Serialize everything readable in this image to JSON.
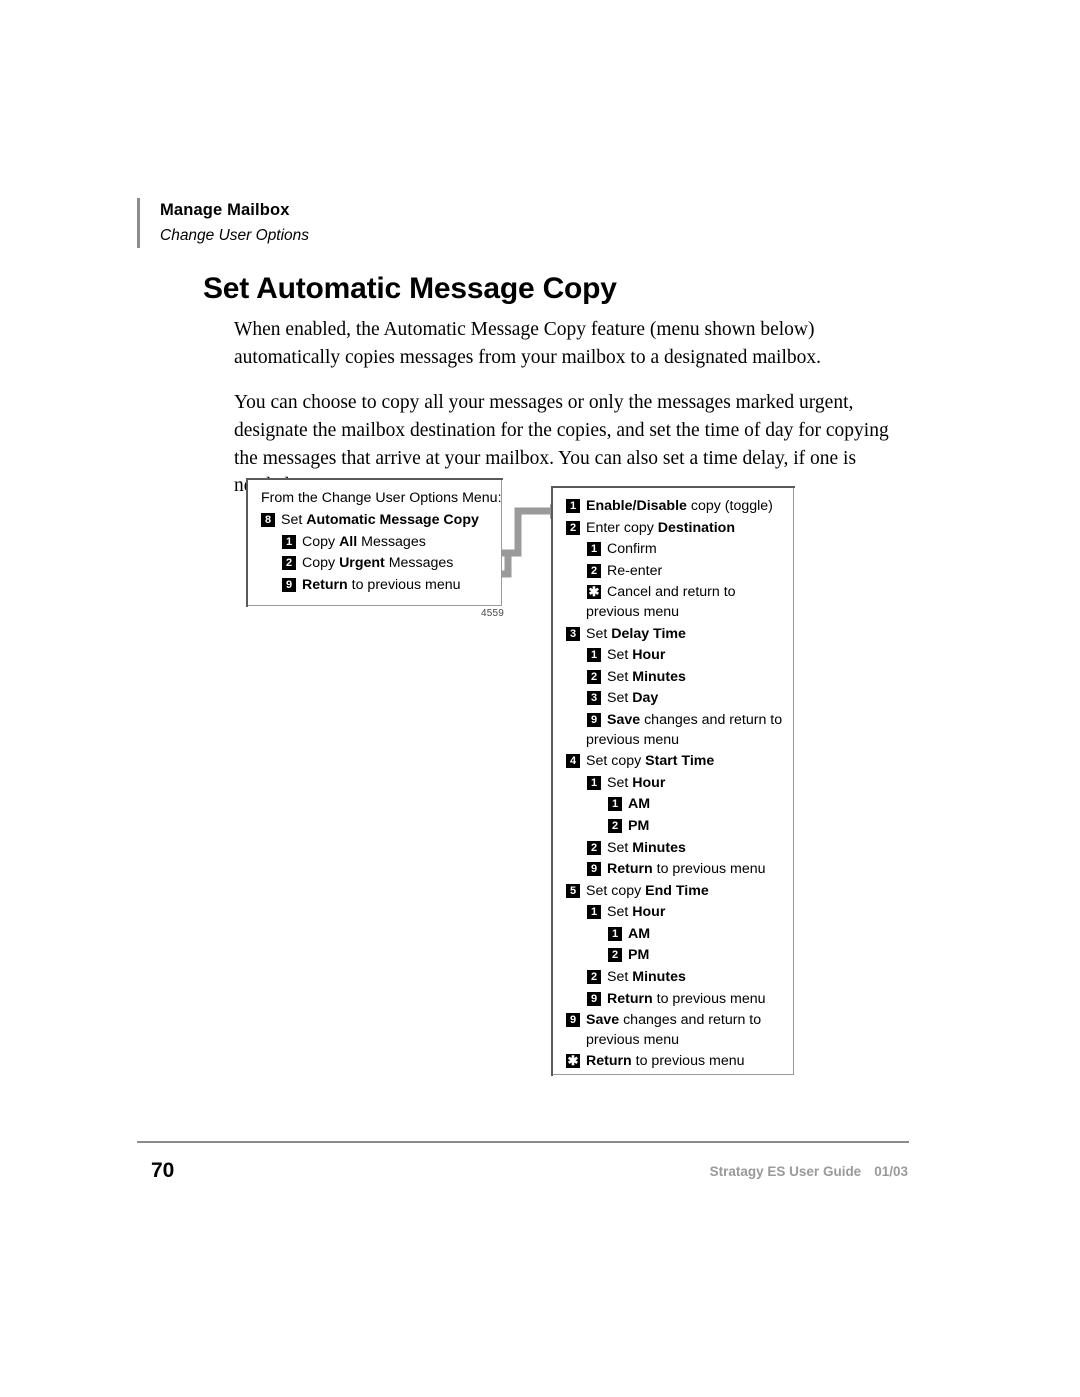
{
  "header": {
    "title": "Manage Mailbox",
    "subtitle": "Change User Options"
  },
  "heading": "Set Automatic Message Copy",
  "body": {
    "paragraph_1": "When enabled, the Automatic Message Copy feature (menu shown below) automatically copies messages from your mailbox to a designated mailbox.",
    "paragraph_2": "You can choose to copy all your messages or only the messages marked urgent, designate the mailbox destination for the copies, and set the time of day for copying the messages that arrive at your mailbox. You can also set a time delay, if one is needed."
  },
  "figure": {
    "id": "4559",
    "left_box": {
      "intro": "From the Change User Options Menu:",
      "items": [
        {
          "key": "8",
          "indent": 0,
          "prefix": "Set ",
          "bold": "Automatic Message Copy",
          "suffix": ""
        },
        {
          "key": "1",
          "indent": 1,
          "prefix": "Copy ",
          "bold": "All",
          "suffix": " Messages"
        },
        {
          "key": "2",
          "indent": 1,
          "prefix": "Copy ",
          "bold": "Urgent",
          "suffix": " Messages"
        },
        {
          "key": "9",
          "indent": 1,
          "prefix": "",
          "bold": "Return",
          "suffix": " to previous menu"
        }
      ]
    },
    "right_box": {
      "items": [
        {
          "key": "1",
          "indent": 0,
          "prefix": "",
          "bold": "Enable/Disable",
          "suffix": " copy (toggle)",
          "cont": ""
        },
        {
          "key": "2",
          "indent": 0,
          "prefix": "Enter copy ",
          "bold": "Destination",
          "suffix": "",
          "cont": ""
        },
        {
          "key": "1",
          "indent": 1,
          "prefix": "Confirm",
          "bold": "",
          "suffix": "",
          "cont": ""
        },
        {
          "key": "2",
          "indent": 1,
          "prefix": "Re-enter",
          "bold": "",
          "suffix": "",
          "cont": ""
        },
        {
          "key": "*",
          "indent": 1,
          "prefix": "Cancel and return to",
          "bold": "",
          "suffix": "",
          "cont": "previous menu"
        },
        {
          "key": "3",
          "indent": 0,
          "prefix": "Set ",
          "bold": "Delay Time",
          "suffix": "",
          "cont": ""
        },
        {
          "key": "1",
          "indent": 1,
          "prefix": "Set ",
          "bold": "Hour",
          "suffix": "",
          "cont": ""
        },
        {
          "key": "2",
          "indent": 1,
          "prefix": "Set ",
          "bold": "Minutes",
          "suffix": "",
          "cont": ""
        },
        {
          "key": "3",
          "indent": 1,
          "prefix": "Set ",
          "bold": "Day",
          "suffix": "",
          "cont": ""
        },
        {
          "key": "9",
          "indent": 1,
          "prefix": "",
          "bold": "Save",
          "suffix": " changes and return to",
          "cont": "previous menu"
        },
        {
          "key": "4",
          "indent": 0,
          "prefix": "Set copy ",
          "bold": "Start Time",
          "suffix": "",
          "cont": ""
        },
        {
          "key": "1",
          "indent": 1,
          "prefix": "Set ",
          "bold": "Hour",
          "suffix": "",
          "cont": ""
        },
        {
          "key": "1",
          "indent": 2,
          "prefix": "",
          "bold": "AM",
          "suffix": "",
          "cont": ""
        },
        {
          "key": "2",
          "indent": 2,
          "prefix": "",
          "bold": "PM",
          "suffix": "",
          "cont": ""
        },
        {
          "key": "2",
          "indent": 1,
          "prefix": "Set ",
          "bold": "Minutes",
          "suffix": "",
          "cont": ""
        },
        {
          "key": "9",
          "indent": 1,
          "prefix": "",
          "bold": "Return",
          "suffix": " to previous menu",
          "cont": ""
        },
        {
          "key": "5",
          "indent": 0,
          "prefix": "Set copy ",
          "bold": "End Time",
          "suffix": "",
          "cont": ""
        },
        {
          "key": "1",
          "indent": 1,
          "prefix": "Set ",
          "bold": "Hour",
          "suffix": "",
          "cont": ""
        },
        {
          "key": "1",
          "indent": 2,
          "prefix": "",
          "bold": "AM",
          "suffix": "",
          "cont": ""
        },
        {
          "key": "2",
          "indent": 2,
          "prefix": "",
          "bold": "PM",
          "suffix": "",
          "cont": ""
        },
        {
          "key": "2",
          "indent": 1,
          "prefix": "Set ",
          "bold": "Minutes",
          "suffix": "",
          "cont": ""
        },
        {
          "key": "9",
          "indent": 1,
          "prefix": "",
          "bold": "Return",
          "suffix": " to previous menu",
          "cont": ""
        },
        {
          "key": "9",
          "indent": 0,
          "prefix": "",
          "bold": "Save",
          "suffix": " changes and return to",
          "cont": "previous menu"
        },
        {
          "key": "*",
          "indent": 0,
          "prefix": "",
          "bold": "Return",
          "suffix": " to previous menu",
          "cont": ""
        }
      ]
    },
    "connector_color": "#9a9a9a"
  },
  "footer": {
    "page_number": "70",
    "guide_name": "Stratagy ES User Guide",
    "date": "01/03"
  }
}
